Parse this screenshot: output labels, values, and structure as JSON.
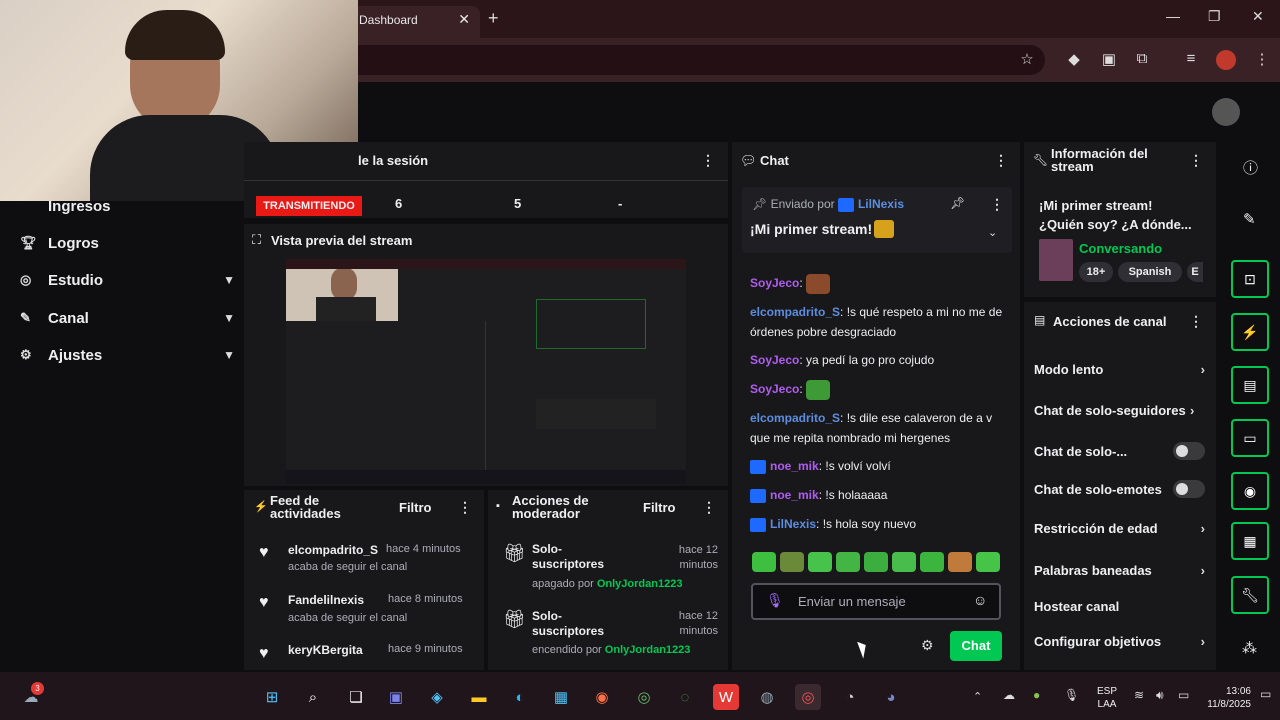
{
  "browser": {
    "tab_title": "Dashboard",
    "tab_close": "✕",
    "new_tab": "+",
    "window_controls": [
      "—",
      "❐",
      "✕"
    ]
  },
  "sidebar": {
    "items": [
      {
        "label": "Ingresos",
        "icon": "money-icon",
        "chevron": false
      },
      {
        "label": "Logros",
        "icon": "trophy-icon",
        "chevron": false
      },
      {
        "label": "Estudio",
        "icon": "studio-icon",
        "chevron": true
      },
      {
        "label": "Canal",
        "icon": "channel-icon",
        "chevron": true
      },
      {
        "label": "Ajustes",
        "icon": "gear-icon",
        "chevron": true
      }
    ]
  },
  "session": {
    "title": "le la sesión",
    "status": "TRANSMITIENDO",
    "stats": [
      "6",
      "5",
      "-"
    ]
  },
  "preview": {
    "title": "Vista previa del stream"
  },
  "feed": {
    "title": "Feed de actividades",
    "filter": "Filtro",
    "items": [
      {
        "name": "elcompadrito_S",
        "time": "hace 4 minutos",
        "sub": "acaba de seguir el canal"
      },
      {
        "name": "Fandelilnexis",
        "time": "hace 8 minutos",
        "sub": "acaba de seguir el canal"
      },
      {
        "name": "keryKBergita",
        "time": "hace 9 minutos",
        "sub": ""
      }
    ]
  },
  "mod": {
    "title": "Acciones de moderador",
    "filter": "Filtro",
    "items": [
      {
        "title": "Solo-suscriptores",
        "time": "hace 12 minutos",
        "state": "apagado por",
        "by": "OnlyJordan1223"
      },
      {
        "title": "Solo-suscriptores",
        "time": "hace 12 minutos",
        "state": "encendido por",
        "by": "OnlyJordan1223"
      }
    ]
  },
  "chat": {
    "title": "Chat",
    "pinned_by_prefix": "Enviado por",
    "pinned_by": "LilNexis",
    "pinned_text": "¡Mi primer stream!",
    "messages": [
      {
        "user": "SoyJeco",
        "text": "",
        "emote": true,
        "color": "purple",
        "badge": false
      },
      {
        "user": "elcompadrito_S",
        "text": ": !s qué respeto a mi no me de órdenes pobre desgraciado",
        "color": "blue",
        "badge": false
      },
      {
        "user": "SoyJeco",
        "text": ": ya pedí la go pro cojudo",
        "color": "purple",
        "badge": false
      },
      {
        "user": "SoyJeco",
        "text": "",
        "emote": true,
        "color": "purple",
        "badge": false
      },
      {
        "user": "elcompadrito_S",
        "text": ": !s dile ese calaveron de a v que me repita nombrado mi hergenes",
        "color": "blue",
        "badge": false
      },
      {
        "user": "noe_mik",
        "text": ": !s volví volví",
        "color": "purple",
        "badge": true
      },
      {
        "user": "noe_mik",
        "text": ": !s holaaaaa",
        "color": "purple",
        "badge": true
      },
      {
        "user": "LilNexis",
        "text": ": !s hola soy nuevo",
        "color": "blue",
        "badge": true
      }
    ],
    "input_placeholder": "Enviar un mensaje",
    "send_label": "Chat"
  },
  "stream_info": {
    "title": "Información del stream",
    "stream_title": "¡Mi primer stream! ¿Quién soy? ¿A dónde...",
    "category": "Conversando",
    "tags": [
      "18+",
      "Spanish",
      "E"
    ]
  },
  "channel_actions": {
    "title": "Acciones de canal",
    "items": [
      {
        "label": "Modo lento",
        "kind": "chevron"
      },
      {
        "label": "Chat de solo-seguidores",
        "kind": "chevron"
      },
      {
        "label": "Chat de solo-...",
        "kind": "toggle"
      },
      {
        "label": "Chat de solo-emotes",
        "kind": "toggle"
      },
      {
        "label": "Restricción de edad",
        "kind": "chevron"
      },
      {
        "label": "Palabras baneadas",
        "kind": "chevron"
      },
      {
        "label": "Hostear canal",
        "kind": "none"
      },
      {
        "label": "Configurar objetivos",
        "kind": "chevron"
      }
    ]
  },
  "taskbar": {
    "lang": "ESP",
    "lang_sub": "LAA",
    "time": "13:06",
    "date": "11/8/2025",
    "notif_count": "3"
  },
  "colors": {
    "accent_green": "#00c853",
    "live_red": "#e91916",
    "user_blue": "#5c8de0",
    "user_purple": "#b05cf0"
  }
}
